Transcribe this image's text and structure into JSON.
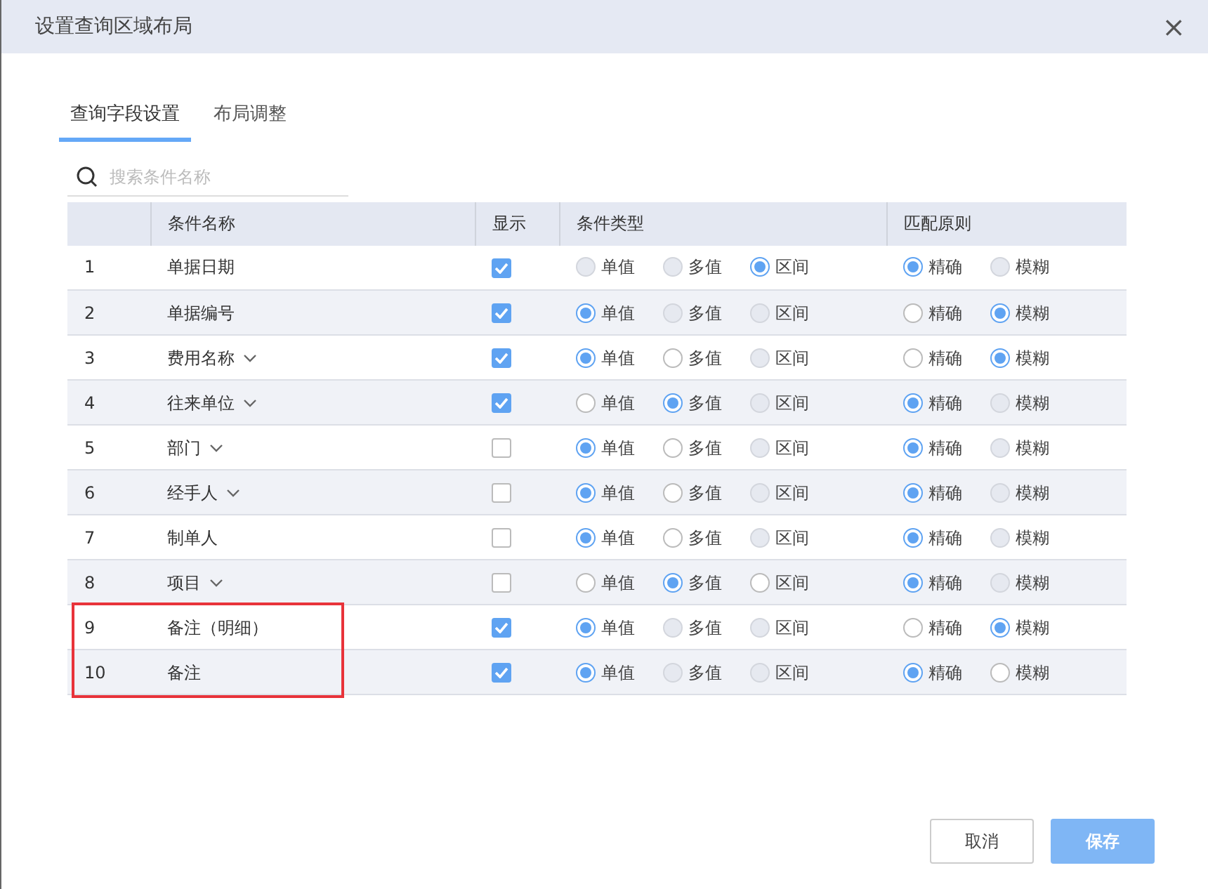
{
  "window": {
    "title": "设置查询区域布局",
    "close": "×"
  },
  "tabs": [
    {
      "label": "查询字段设置",
      "selected": true
    },
    {
      "label": "布局调整",
      "selected": false
    }
  ],
  "search": {
    "placeholder": "搜索条件名称"
  },
  "table": {
    "columns": [
      "",
      "条件名称",
      "显示",
      "条件类型",
      "匹配原则"
    ],
    "rows": [
      {
        "index": "1",
        "name": "单据日期",
        "dropdown": false,
        "shown": true,
        "highlighted": false,
        "type": [
          {
            "label": "单值",
            "selected": false,
            "disabled": true
          },
          {
            "label": "多值",
            "selected": false,
            "disabled": true
          },
          {
            "label": "区间",
            "selected": true,
            "disabled": false
          }
        ],
        "match": [
          {
            "label": "精确",
            "selected": true,
            "disabled": false
          },
          {
            "label": "模糊",
            "selected": false,
            "disabled": true
          }
        ]
      },
      {
        "index": "2",
        "name": "单据编号",
        "dropdown": false,
        "shown": true,
        "highlighted": false,
        "type": [
          {
            "label": "单值",
            "selected": true,
            "disabled": false
          },
          {
            "label": "多值",
            "selected": false,
            "disabled": true
          },
          {
            "label": "区间",
            "selected": false,
            "disabled": true
          }
        ],
        "match": [
          {
            "label": "精确",
            "selected": false,
            "disabled": false
          },
          {
            "label": "模糊",
            "selected": true,
            "disabled": false
          }
        ]
      },
      {
        "index": "3",
        "name": "费用名称",
        "dropdown": true,
        "shown": true,
        "highlighted": false,
        "type": [
          {
            "label": "单值",
            "selected": true,
            "disabled": false
          },
          {
            "label": "多值",
            "selected": false,
            "disabled": false
          },
          {
            "label": "区间",
            "selected": false,
            "disabled": true
          }
        ],
        "match": [
          {
            "label": "精确",
            "selected": false,
            "disabled": false
          },
          {
            "label": "模糊",
            "selected": true,
            "disabled": false
          }
        ]
      },
      {
        "index": "4",
        "name": "往来单位",
        "dropdown": true,
        "shown": true,
        "highlighted": false,
        "type": [
          {
            "label": "单值",
            "selected": false,
            "disabled": false
          },
          {
            "label": "多值",
            "selected": true,
            "disabled": false
          },
          {
            "label": "区间",
            "selected": false,
            "disabled": true
          }
        ],
        "match": [
          {
            "label": "精确",
            "selected": true,
            "disabled": false
          },
          {
            "label": "模糊",
            "selected": false,
            "disabled": true
          }
        ]
      },
      {
        "index": "5",
        "name": "部门",
        "dropdown": true,
        "shown": false,
        "highlighted": false,
        "type": [
          {
            "label": "单值",
            "selected": true,
            "disabled": false
          },
          {
            "label": "多值",
            "selected": false,
            "disabled": false
          },
          {
            "label": "区间",
            "selected": false,
            "disabled": true
          }
        ],
        "match": [
          {
            "label": "精确",
            "selected": true,
            "disabled": false
          },
          {
            "label": "模糊",
            "selected": false,
            "disabled": true
          }
        ]
      },
      {
        "index": "6",
        "name": "经手人",
        "dropdown": true,
        "shown": false,
        "highlighted": false,
        "type": [
          {
            "label": "单值",
            "selected": true,
            "disabled": false
          },
          {
            "label": "多值",
            "selected": false,
            "disabled": false
          },
          {
            "label": "区间",
            "selected": false,
            "disabled": true
          }
        ],
        "match": [
          {
            "label": "精确",
            "selected": true,
            "disabled": false
          },
          {
            "label": "模糊",
            "selected": false,
            "disabled": true
          }
        ]
      },
      {
        "index": "7",
        "name": "制单人",
        "dropdown": false,
        "shown": false,
        "highlighted": false,
        "type": [
          {
            "label": "单值",
            "selected": true,
            "disabled": false
          },
          {
            "label": "多值",
            "selected": false,
            "disabled": false
          },
          {
            "label": "区间",
            "selected": false,
            "disabled": true
          }
        ],
        "match": [
          {
            "label": "精确",
            "selected": true,
            "disabled": false
          },
          {
            "label": "模糊",
            "selected": false,
            "disabled": true
          }
        ]
      },
      {
        "index": "8",
        "name": "项目",
        "dropdown": true,
        "shown": false,
        "highlighted": false,
        "type": [
          {
            "label": "单值",
            "selected": false,
            "disabled": false
          },
          {
            "label": "多值",
            "selected": true,
            "disabled": false
          },
          {
            "label": "区间",
            "selected": false,
            "disabled": false
          }
        ],
        "match": [
          {
            "label": "精确",
            "selected": true,
            "disabled": false
          },
          {
            "label": "模糊",
            "selected": false,
            "disabled": true
          }
        ]
      },
      {
        "index": "9",
        "name": "备注（明细）",
        "dropdown": false,
        "shown": true,
        "highlighted": true,
        "type": [
          {
            "label": "单值",
            "selected": true,
            "disabled": false
          },
          {
            "label": "多值",
            "selected": false,
            "disabled": true
          },
          {
            "label": "区间",
            "selected": false,
            "disabled": true
          }
        ],
        "match": [
          {
            "label": "精确",
            "selected": false,
            "disabled": false
          },
          {
            "label": "模糊",
            "selected": true,
            "disabled": false
          }
        ]
      },
      {
        "index": "10",
        "name": "备注",
        "dropdown": false,
        "shown": true,
        "highlighted": true,
        "type": [
          {
            "label": "单值",
            "selected": true,
            "disabled": false
          },
          {
            "label": "多值",
            "selected": false,
            "disabled": true
          },
          {
            "label": "区间",
            "selected": false,
            "disabled": true
          }
        ],
        "match": [
          {
            "label": "精确",
            "selected": true,
            "disabled": false
          },
          {
            "label": "模糊",
            "selected": false,
            "disabled": false
          }
        ]
      }
    ]
  },
  "buttons": [
    {
      "label": "取消",
      "kind": "secondary"
    },
    {
      "label": "保存",
      "kind": "primary"
    }
  ]
}
